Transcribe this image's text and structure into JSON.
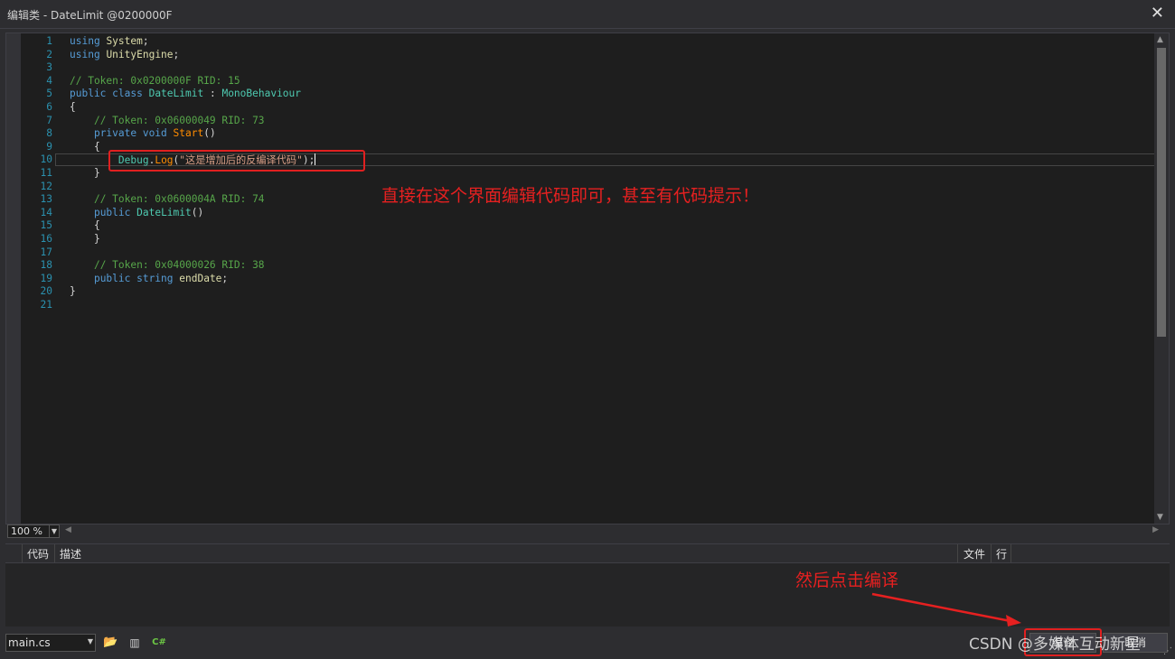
{
  "window": {
    "title": "编辑类 - DateLimit @0200000F",
    "close_glyph": "✕"
  },
  "editor": {
    "lines": [
      {
        "n": "1",
        "html": "<span class=\"kw\">using</span> <span class=\"ty\">System</span><span class=\"pl\">;</span>"
      },
      {
        "n": "2",
        "html": "<span class=\"kw\">using</span> <span class=\"ty\">UnityEngine</span><span class=\"pl\">;</span>"
      },
      {
        "n": "3",
        "html": ""
      },
      {
        "n": "4",
        "html": "<span class=\"cm\">// Token: 0x0200000F RID: 15</span>"
      },
      {
        "n": "5",
        "html": "<span class=\"kw\">public class</span> <span class=\"cls\">DateLimit</span> <span class=\"pl\">:</span> <span class=\"cls\">MonoBehaviour</span>"
      },
      {
        "n": "6",
        "html": "<span class=\"pl\">{</span>"
      },
      {
        "n": "7",
        "html": "    <span class=\"cm\">// Token: 0x06000049 RID: 73</span>"
      },
      {
        "n": "8",
        "html": "    <span class=\"kw\">private void</span> <span class=\"or\">Start</span><span class=\"pl\">()</span>"
      },
      {
        "n": "9",
        "html": "    <span class=\"pl\">{</span>"
      },
      {
        "n": "10",
        "html": "        <span class=\"cls\">Debug</span><span class=\"pl\">.</span><span class=\"or\">Log</span><span class=\"pl\">(</span><span class=\"str\">\"这是增加后的反编译代码\"</span><span class=\"pl\">);</span><span class=\"caret\"></span>",
        "current": true
      },
      {
        "n": "11",
        "html": "    <span class=\"pl\">}</span>"
      },
      {
        "n": "12",
        "html": ""
      },
      {
        "n": "13",
        "html": "    <span class=\"cm\">// Token: 0x0600004A RID: 74</span>"
      },
      {
        "n": "14",
        "html": "    <span class=\"kw\">public</span> <span class=\"cls\">DateLimit</span><span class=\"pl\">()</span>"
      },
      {
        "n": "15",
        "html": "    <span class=\"pl\">{</span>"
      },
      {
        "n": "16",
        "html": "    <span class=\"pl\">}</span>"
      },
      {
        "n": "17",
        "html": ""
      },
      {
        "n": "18",
        "html": "    <span class=\"cm\">// Token: 0x04000026 RID: 38</span>"
      },
      {
        "n": "19",
        "html": "    <span class=\"kw\">public string</span> <span class=\"ty\">endDate</span><span class=\"pl\">;</span>"
      },
      {
        "n": "20",
        "html": "<span class=\"pl\">}</span>"
      },
      {
        "n": "21",
        "html": ""
      }
    ]
  },
  "annotations": {
    "editor_note": "直接在这个界面编辑代码即可，甚至有代码提示！",
    "compile_note": "然后点击编译"
  },
  "zoom": {
    "value": "100 %"
  },
  "error_list": {
    "col_code": "代码",
    "col_desc": "描述",
    "col_file": "文件",
    "col_line": "行"
  },
  "bottom": {
    "file_selected": "main.cs",
    "compile_label": "编译",
    "cancel_label": "取消",
    "watermark": "CSDN @多媒体互动新星"
  },
  "colors": {
    "annotation_red": "#e62020",
    "editor_bg": "#1e1e1e",
    "chrome_bg": "#2d2d30"
  }
}
